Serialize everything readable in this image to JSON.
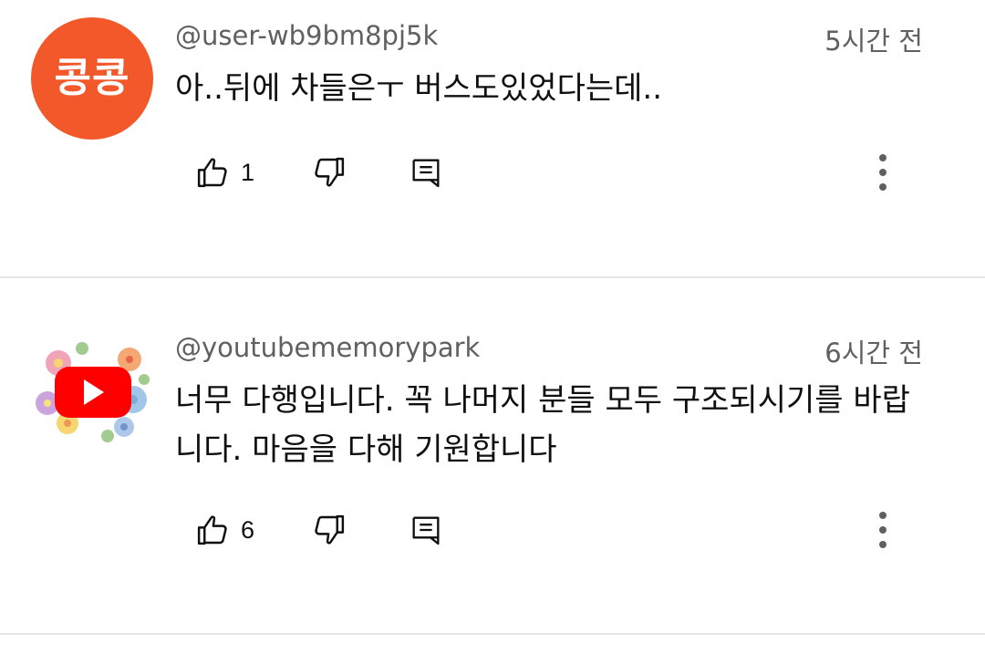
{
  "comments": [
    {
      "avatar": {
        "text": "콩콩",
        "color": "#f2582a"
      },
      "handle": "@user-wb9bm8pj5k",
      "time": "5시간 전",
      "text": "아..뒤에 차들은ㅜ 버스도있었다는데..",
      "likes": "1",
      "icons": [
        "thumb-up-icon",
        "thumb-down-icon",
        "reply-icon",
        "more-vert-icon"
      ]
    },
    {
      "avatar": {
        "image": "youtube-logo-with-flowers"
      },
      "handle": "@youtubememorypark",
      "time": "6시간 전",
      "text": "너무 다행입니다. 꼭 나머지 분들 모두 구조되시기를 바랍니다. 마음을 다해 기원합니다",
      "likes": "6",
      "icons": [
        "thumb-up-icon",
        "thumb-down-icon",
        "reply-icon",
        "more-vert-icon"
      ]
    }
  ],
  "colors": {
    "text_primary": "#0f0f0f",
    "text_secondary": "#606060",
    "divider": "#e5e5e5",
    "youtube_red": "#ff0000"
  }
}
